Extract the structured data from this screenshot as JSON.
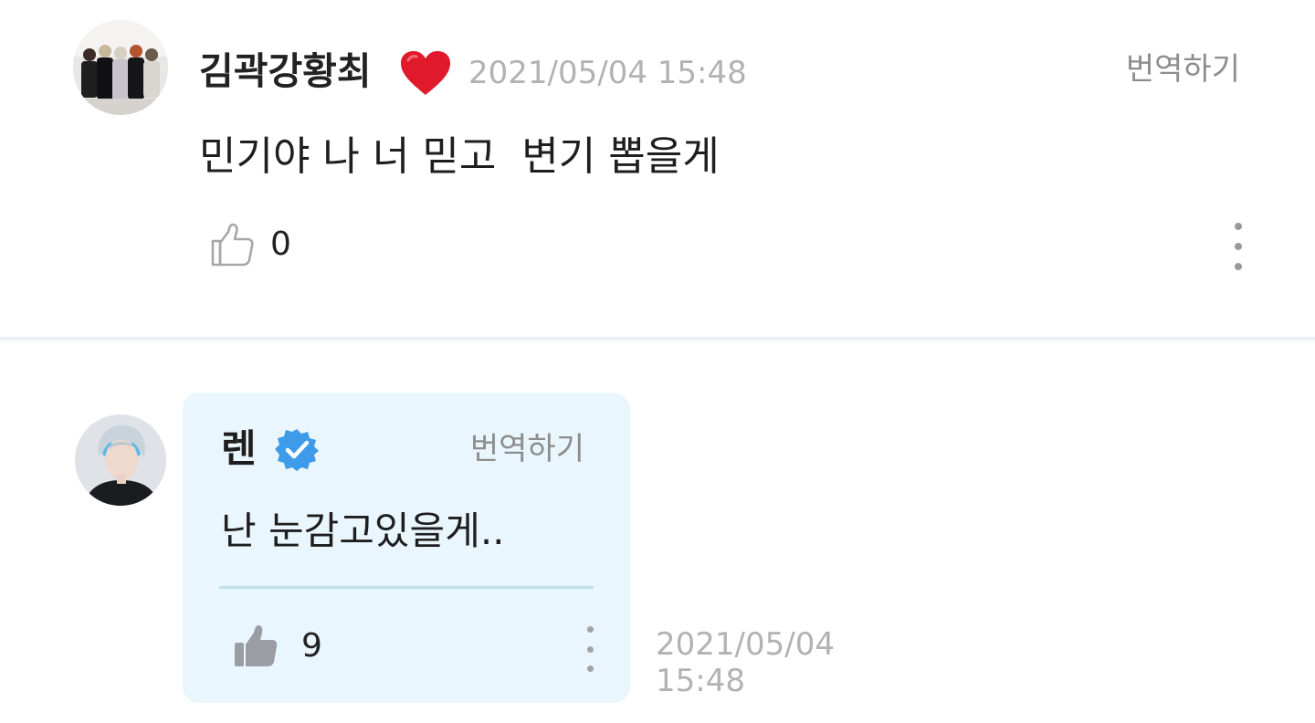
{
  "comment": {
    "author": "김곽강황최",
    "heart_icon": "red-heart-icon",
    "timestamp": "2021/05/04 15:48",
    "translate_label": "번역하기",
    "text": "민기야 나 너 믿고  변기 뽑을게",
    "like_count": "0",
    "like_icon": "thumbs-up-outline-icon",
    "more_icon": "vertical-ellipsis-icon"
  },
  "reply": {
    "author": "렌",
    "verified_icon": "verified-badge-icon",
    "translate_label": "번역하기",
    "text": "난 눈감고있을게..",
    "like_count": "9",
    "like_icon": "thumbs-up-filled-icon",
    "more_icon": "vertical-ellipsis-icon",
    "date": "2021/05/04",
    "time": "15:48"
  },
  "colors": {
    "reply_background": "#eaf6fd",
    "verified_badge": "#3d9be9",
    "heart": "#e0192b",
    "muted_text": "#b2b2b2"
  }
}
